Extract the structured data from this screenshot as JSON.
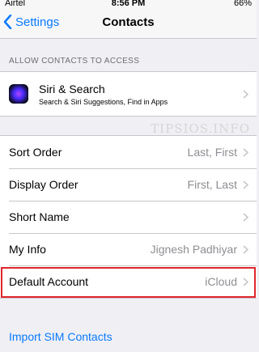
{
  "status_bar": {
    "carrier": "Airtel",
    "time": "8:56 PM",
    "battery": "66%"
  },
  "nav": {
    "back_label": "Settings",
    "title": "Contacts"
  },
  "section_header": "ALLOW CONTACTS TO ACCESS",
  "siri": {
    "title": "Siri & Search",
    "subtitle": "Search & Siri Suggestions, Find in Apps"
  },
  "watermark": "TIPSIOS.INFO",
  "settings": [
    {
      "label": "Sort Order",
      "value": "Last, First"
    },
    {
      "label": "Display Order",
      "value": "First, Last"
    },
    {
      "label": "Short Name",
      "value": ""
    },
    {
      "label": "My Info",
      "value": "Jignesh Padhiyar"
    },
    {
      "label": "Default Account",
      "value": "iCloud"
    }
  ],
  "import_label": "Import SIM Contacts",
  "colors": {
    "accent": "#0a7aff",
    "highlight": "#e0262b"
  }
}
